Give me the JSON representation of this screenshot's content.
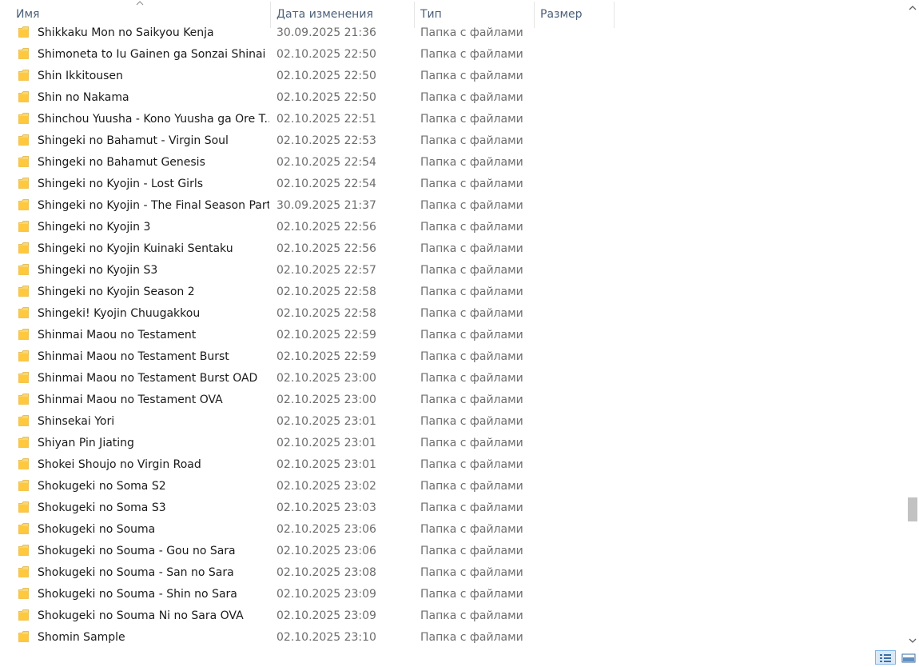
{
  "columns": {
    "name": "Имя",
    "date": "Дата изменения",
    "type": "Тип",
    "size": "Размер"
  },
  "rows": [
    {
      "name": "Shikkaku Mon no Saikyou Kenja",
      "date": "30.09.2025 21:36",
      "type": "Папка с файлами"
    },
    {
      "name": "Shimoneta to Iu Gainen ga Sonzai Shinai ...",
      "date": "02.10.2025 22:50",
      "type": "Папка с файлами"
    },
    {
      "name": "Shin Ikkitousen",
      "date": "02.10.2025 22:50",
      "type": "Папка с файлами"
    },
    {
      "name": "Shin no Nakama",
      "date": "02.10.2025 22:50",
      "type": "Папка с файлами"
    },
    {
      "name": "Shinchou Yuusha - Kono Yuusha ga Ore T...",
      "date": "02.10.2025 22:51",
      "type": "Папка с файлами"
    },
    {
      "name": "Shingeki no Bahamut - Virgin Soul",
      "date": "02.10.2025 22:53",
      "type": "Папка с файлами"
    },
    {
      "name": "Shingeki no Bahamut Genesis",
      "date": "02.10.2025 22:54",
      "type": "Папка с файлами"
    },
    {
      "name": "Shingeki no Kyojin - Lost Girls",
      "date": "02.10.2025 22:54",
      "type": "Папка с файлами"
    },
    {
      "name": "Shingeki no Kyojin - The Final Season Part",
      "date": "30.09.2025 21:37",
      "type": "Папка с файлами"
    },
    {
      "name": "Shingeki no Kyojin 3",
      "date": "02.10.2025 22:56",
      "type": "Папка с файлами"
    },
    {
      "name": "Shingeki no Kyojin Kuinaki Sentaku",
      "date": "02.10.2025 22:56",
      "type": "Папка с файлами"
    },
    {
      "name": "Shingeki no Kyojin S3",
      "date": "02.10.2025 22:57",
      "type": "Папка с файлами"
    },
    {
      "name": "Shingeki no Kyojin Season 2",
      "date": "02.10.2025 22:58",
      "type": "Папка с файлами"
    },
    {
      "name": "Shingeki! Kyojin Chuugakkou",
      "date": "02.10.2025 22:58",
      "type": "Папка с файлами"
    },
    {
      "name": "Shinmai Maou no Testament",
      "date": "02.10.2025 22:59",
      "type": "Папка с файлами"
    },
    {
      "name": "Shinmai Maou no Testament Burst",
      "date": "02.10.2025 22:59",
      "type": "Папка с файлами"
    },
    {
      "name": "Shinmai Maou no Testament Burst OAD",
      "date": "02.10.2025 23:00",
      "type": "Папка с файлами"
    },
    {
      "name": "Shinmai Maou no Testament OVA",
      "date": "02.10.2025 23:00",
      "type": "Папка с файлами"
    },
    {
      "name": "Shinsekai Yori",
      "date": "02.10.2025 23:01",
      "type": "Папка с файлами"
    },
    {
      "name": "Shiyan Pin Jiating",
      "date": "02.10.2025 23:01",
      "type": "Папка с файлами"
    },
    {
      "name": "Shokei Shoujo no Virgin Road",
      "date": "02.10.2025 23:01",
      "type": "Папка с файлами"
    },
    {
      "name": "Shokugeki no Soma S2",
      "date": "02.10.2025 23:02",
      "type": "Папка с файлами"
    },
    {
      "name": "Shokugeki no Soma S3",
      "date": "02.10.2025 23:03",
      "type": "Папка с файлами"
    },
    {
      "name": "Shokugeki no Souma",
      "date": "02.10.2025 23:06",
      "type": "Папка с файлами"
    },
    {
      "name": "Shokugeki no Souma - Gou no Sara",
      "date": "02.10.2025 23:06",
      "type": "Папка с файлами"
    },
    {
      "name": "Shokugeki no Souma - San no Sara",
      "date": "02.10.2025 23:08",
      "type": "Папка с файлами"
    },
    {
      "name": "Shokugeki no Souma - Shin no Sara",
      "date": "02.10.2025 23:09",
      "type": "Папка с файлами"
    },
    {
      "name": "Shokugeki no Souma Ni no Sara OVA",
      "date": "02.10.2025 23:09",
      "type": "Папка с файлами"
    },
    {
      "name": "Shomin Sample",
      "date": "02.10.2025 23:10",
      "type": "Папка с файлами"
    }
  ],
  "icons": {
    "folder": "folder-icon",
    "sort": "sort-ascending-icon",
    "view_details": "details-view-icon",
    "view_tiles": "large-icons-view-icon"
  },
  "colors": {
    "folder": "#f5c842",
    "header_text": "#4c607a",
    "secondary_text": "#6d6d6d"
  }
}
